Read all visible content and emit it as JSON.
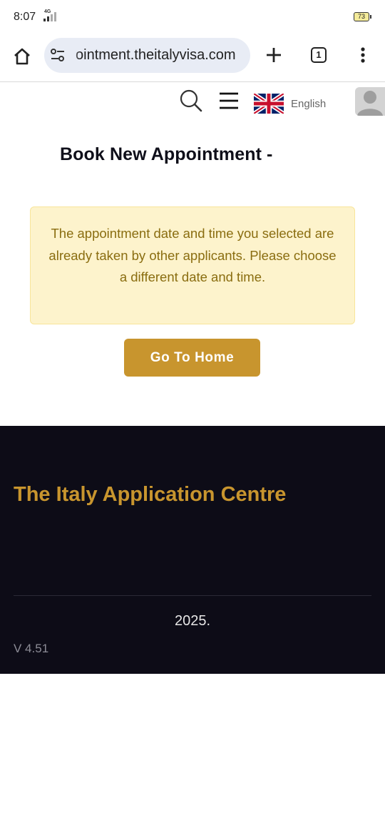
{
  "status_bar": {
    "time": "8:07",
    "network": "4G",
    "battery": "73"
  },
  "browser": {
    "url": "ointment.theitalyvisa.com",
    "tab_count": "1"
  },
  "header": {
    "language": "English"
  },
  "page": {
    "title": "Book New Appointment -",
    "alert": "The appointment date and time you selected are already taken by other applicants. Please choose a different date and time.",
    "home_button": "Go To Home"
  },
  "footer": {
    "brand": "The Italy Application Centre",
    "year": "2025.",
    "version": "V 4.51"
  },
  "colors": {
    "accent": "#c8952e",
    "alert_bg": "#fdf3cc",
    "alert_text": "#8a6d10",
    "footer_bg": "#0d0c17"
  }
}
